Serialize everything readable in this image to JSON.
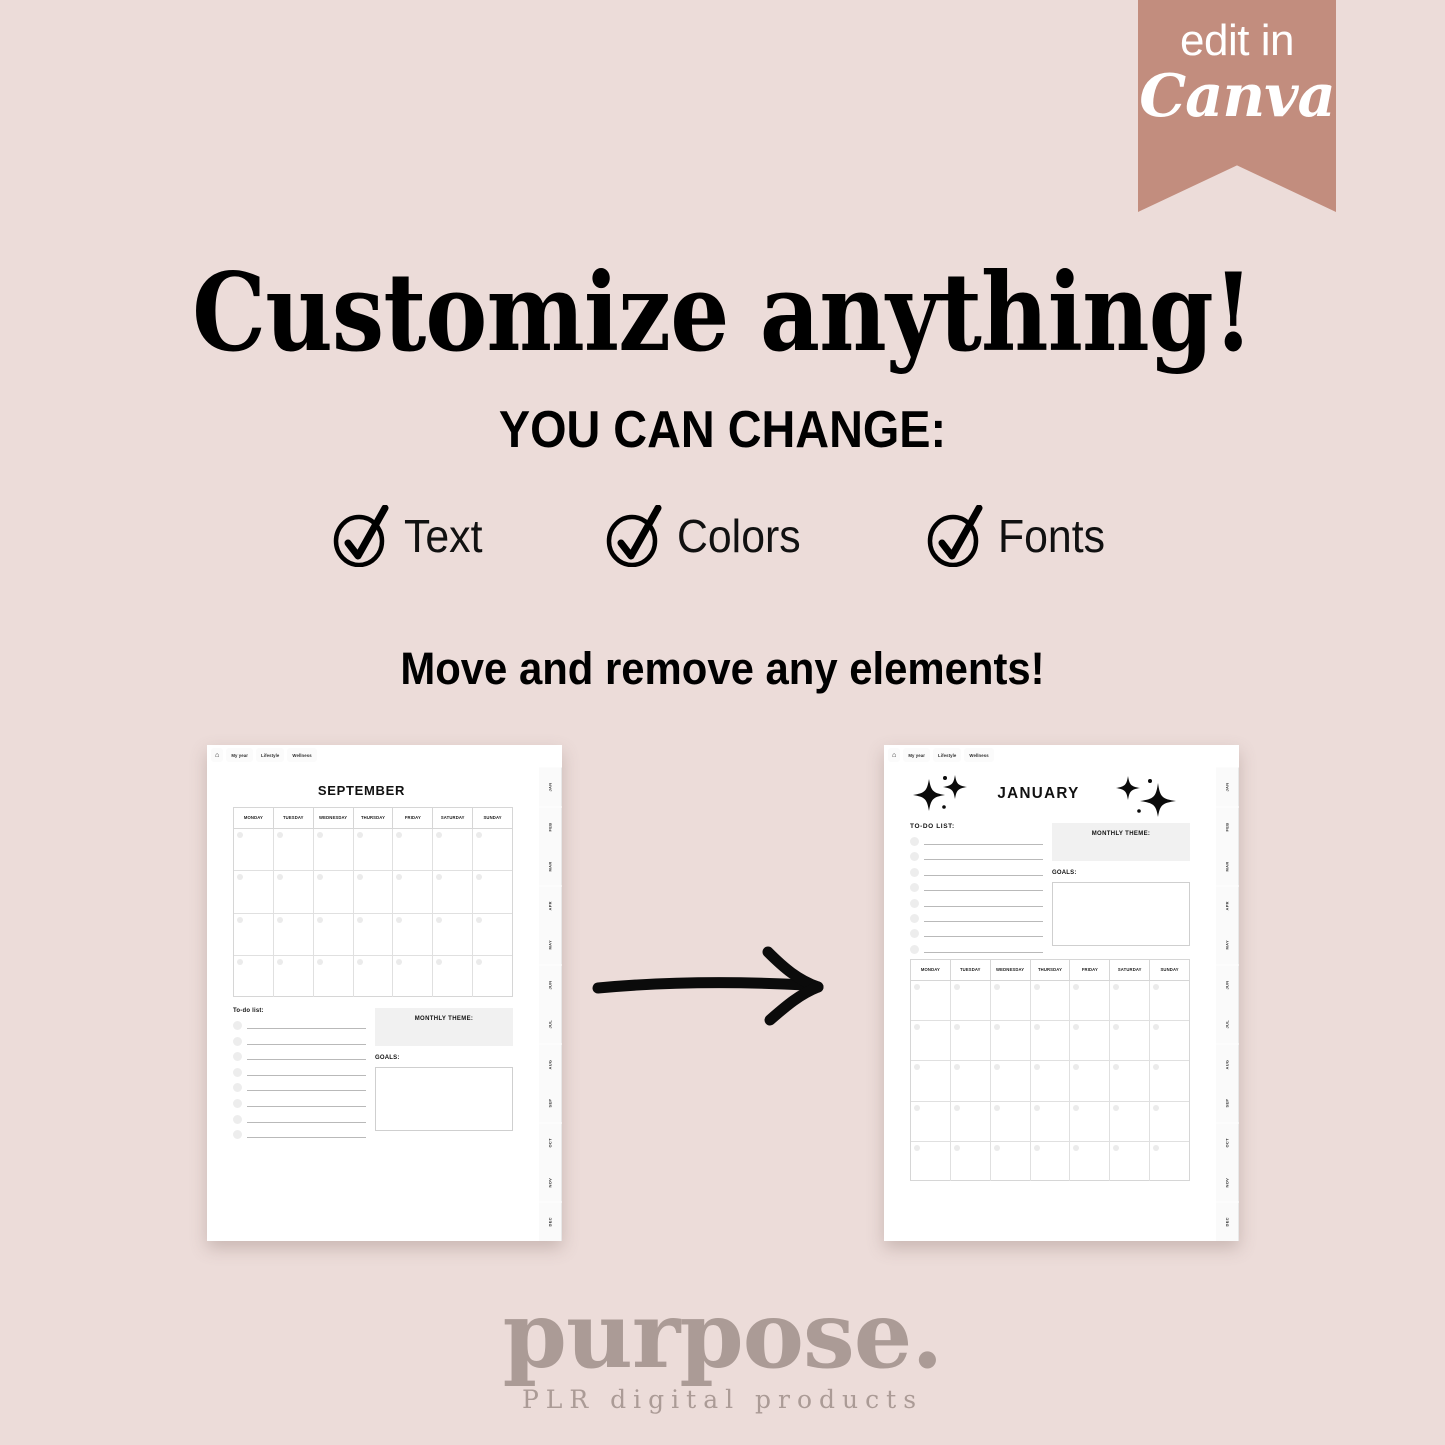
{
  "theme": {
    "background": "#ecdcd9",
    "ribbon": "#c28d7e",
    "text": "#000000",
    "brand": "#ab9b96",
    "page": "#ffffff"
  },
  "ribbon": {
    "line1": "edit in",
    "line2": "Canva"
  },
  "headline": "Customize anything!",
  "subhead": "YOU CAN CHANGE:",
  "checks": [
    {
      "label": "Text",
      "icon": "check-circle-icon"
    },
    {
      "label": "Colors",
      "icon": "check-circle-icon"
    },
    {
      "label": "Fonts",
      "icon": "check-circle-icon"
    }
  ],
  "move_line": "Move and remove any elements!",
  "arrow": {
    "icon": "arrow-right-icon"
  },
  "pages": {
    "left": {
      "tabs": [
        {
          "label": "🏠",
          "icon": "home-icon"
        },
        {
          "label": "My year"
        },
        {
          "label": "Lifestyle"
        },
        {
          "label": "Wellness"
        }
      ],
      "month_title": "SEPTEMBER",
      "rail_months": [
        "JAN",
        "FEB",
        "MAR",
        "APR",
        "MAY",
        "JUN",
        "JUL",
        "AUG",
        "SEP",
        "OCT",
        "NOV",
        "DEC"
      ],
      "weekdays": [
        "MONDAY",
        "TUESDAY",
        "WEDNESDAY",
        "THURSDAY",
        "FRIDAY",
        "SATURDAY",
        "SUNDAY"
      ],
      "calendar_rows": 4,
      "todo_title": "To-do list:",
      "todo_rows": 8,
      "theme_title": "MONTHLY THEME:",
      "goals_title": "GOALS:"
    },
    "right": {
      "tabs": [
        {
          "label": "🏠",
          "icon": "home-icon"
        },
        {
          "label": "My year"
        },
        {
          "label": "Lifestyle"
        },
        {
          "label": "Wellness"
        }
      ],
      "month_title": "JANUARY",
      "rail_months": [
        "JAN",
        "FEB",
        "MAR",
        "APR",
        "MAY",
        "JUN",
        "JUL",
        "AUG",
        "SEP",
        "OCT",
        "NOV",
        "DEC"
      ],
      "weekdays": [
        "MONDAY",
        "TUESDAY",
        "WEDNESDAY",
        "THURSDAY",
        "FRIDAY",
        "SATURDAY",
        "SUNDAY"
      ],
      "calendar_rows": 5,
      "todo_title": "TO-DO LIST:",
      "todo_rows": 8,
      "theme_title": "MONTHLY THEME:",
      "goals_title": "GOALS:"
    }
  },
  "brand": {
    "name": "purpose.",
    "tagline": "PLR digital products"
  }
}
